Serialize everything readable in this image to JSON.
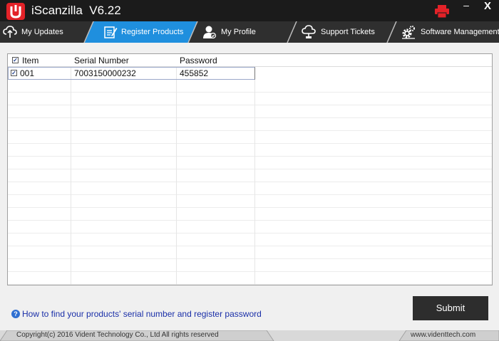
{
  "app": {
    "title": "iScanzilla  V6.22",
    "minimize": "–",
    "close": "X",
    "accent_color": "#e32228"
  },
  "nav": {
    "tabs": [
      {
        "label": "My Updates",
        "icon": "cloud-upload-icon",
        "active": false
      },
      {
        "label": "Register Products",
        "icon": "register-icon",
        "active": true
      },
      {
        "label": "My Profile",
        "icon": "user-profile-icon",
        "active": false
      },
      {
        "label": "Support Tickets",
        "icon": "support-cloud-icon",
        "active": false
      },
      {
        "label": "Software Management",
        "icon": "gear-settings-icon",
        "active": false
      }
    ],
    "active_color": "#1f8fde"
  },
  "table": {
    "columns": [
      "Item",
      "Serial Number",
      "Password"
    ],
    "header_checked": true,
    "rows": [
      {
        "checked": true,
        "item": "001",
        "serial": "7003150000232",
        "password": "455852"
      }
    ]
  },
  "help": {
    "link_text": "How to find your products' serial number and register password",
    "icon": "?"
  },
  "submit_label": "Submit",
  "footer": {
    "copyright": "Copyright(c) 2016 Vident Technology Co., Ltd All rights reserved",
    "website": "www.videnttech.com"
  }
}
